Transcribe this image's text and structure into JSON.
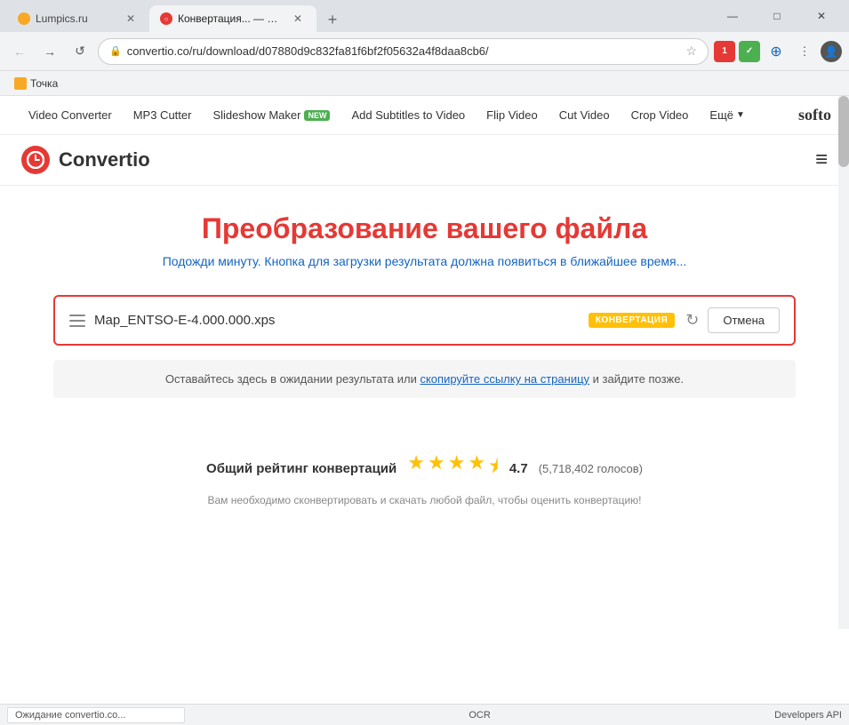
{
  "browser": {
    "tabs": [
      {
        "id": "tab1",
        "label": "Lumpics.ru",
        "favicon_type": "yellow",
        "active": false
      },
      {
        "id": "tab2",
        "label": "Конвертация... — Convertio",
        "favicon_type": "convertio",
        "active": true
      }
    ],
    "new_tab_symbol": "+",
    "window_controls": [
      "—",
      "□",
      "✕"
    ],
    "url": "convertio.co/ru/download/d07880d9c832fa81f6bf2f05632a4f8daa8cb6/",
    "lock_icon": "🔒",
    "bookmark_items": [
      {
        "label": "Точка"
      }
    ],
    "ext_buttons": [
      {
        "label": "1",
        "color": "#e53935"
      },
      {
        "label": "✓",
        "color": "#4caf50"
      },
      {
        "label": "⊕",
        "color": "#1565c0"
      },
      {
        "label": "≡",
        "color": "#555"
      }
    ]
  },
  "navbar": {
    "items": [
      {
        "label": "Video Converter",
        "active": false
      },
      {
        "label": "MP3 Cutter",
        "active": false
      },
      {
        "label": "Slideshow Maker",
        "badge": "NEW",
        "active": false
      },
      {
        "label": "Add Subtitles to Video",
        "active": false
      },
      {
        "label": "Flip Video",
        "active": false
      },
      {
        "label": "Cut Video",
        "active": false
      },
      {
        "label": "Crop Video",
        "active": false
      },
      {
        "label": "Ещё",
        "dropdown": true,
        "active": false
      }
    ],
    "logo_right": "softo"
  },
  "logo": {
    "icon": "○",
    "text": "Convertio",
    "menu_icon": "≡"
  },
  "main": {
    "title": "Преобразование вашего файла",
    "subtitle": "Подожди минуту. Кнопка для загрузки результата должна появиться в ближайшее время...",
    "file_row": {
      "file_icon": "≡",
      "file_name": "Map_ENTSO-E-4.000.000.xps",
      "badge": "КОНВЕРТАЦИЯ",
      "refresh_icon": "↻",
      "cancel_label": "Отмена"
    },
    "info_text_before": "Оставайтесь здесь в ожидании результата или ",
    "info_link": "скопируйте ссылку на страницу",
    "info_text_after": " и зайдите позже.",
    "rating": {
      "label": "Общий рейтинг конвертаций",
      "stars": [
        {
          "type": "full"
        },
        {
          "type": "full"
        },
        {
          "type": "full"
        },
        {
          "type": "full"
        },
        {
          "type": "half"
        }
      ],
      "score": "4.7",
      "count": "(5,718,402 голосов)",
      "note": "Вам необходимо сконвертировать и скачать любой файл, чтобы оценить конвертацию!"
    }
  },
  "status_bar": {
    "url": "Ожидание convertio.co...",
    "center": "OCR",
    "right": "Developers API"
  }
}
